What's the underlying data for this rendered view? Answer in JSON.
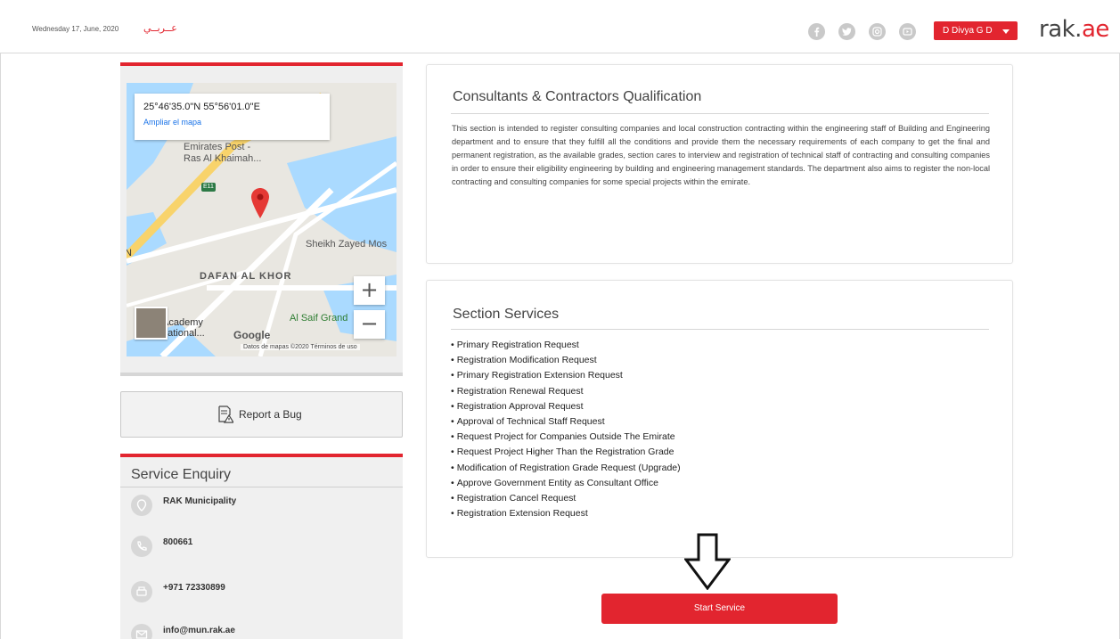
{
  "header": {
    "date": "Wednesday 17, June, 2020",
    "language_link": "عــربــي",
    "user_label": "D Divya G D",
    "brand_prefix": "rak.",
    "brand_suffix": "ae",
    "social_icons": [
      "facebook-icon",
      "twitter-icon",
      "instagram-icon",
      "youtube-icon"
    ]
  },
  "map": {
    "coordinates": "25°46'35.0\"N 55°56'01.0\"E",
    "expand_link": "Ampliar el mapa",
    "labels": {
      "emirates_post": "Emirates Post -",
      "ras_al_khaimah": "Ras Al Khaimah...",
      "sheikh_zayed": "Sheikh Zayed Mos",
      "dafan_al_khor": "DAFAN AL KHOR",
      "al_saif_grand": "Al Saif Grand",
      "academy": "Academy",
      "national": "national...",
      "road_e11": "E11",
      "side_n": "N"
    },
    "google_logo": "Google",
    "attribution": "Datos de mapas ©2020   Términos de uso",
    "zoom_in": "+",
    "zoom_out": "−"
  },
  "report_bug": {
    "label": "Report a Bug"
  },
  "service_enquiry": {
    "title": "Service Enquiry",
    "items": [
      {
        "icon": "location-icon",
        "text": "RAK Municipality"
      },
      {
        "icon": "phone-icon",
        "text": "800661"
      },
      {
        "icon": "fax-icon",
        "text": "+971 72330899"
      },
      {
        "icon": "email-icon",
        "text": "info@mun.rak.ae"
      }
    ]
  },
  "qualification": {
    "title": "Consultants & Contractors Qualification",
    "description": "This section is intended to register consulting companies and local construction contracting within the engineering staff of Building and Engineering department and to ensure that they fulfill all the conditions and provide them the necessary requirements of each company to get the final and permanent registration, as the available grades, section cares to interview and registration of technical staff of contracting and consulting companies in order to ensure their eligibility engineering by building and engineering management standards. The department also aims to register the non-local contracting and consulting companies for some special projects within the emirate."
  },
  "section_services": {
    "title": "Section Services",
    "items": [
      "Primary Registration Request",
      "Registration Modification Request",
      "Primary Registration Extension Request",
      "Registration Renewal Request",
      "Registration Approval Request",
      "Approval of Technical Staff Request",
      "Request Project for Companies Outside The Emirate",
      "Request Project Higher Than the Registration Grade",
      "Modification of Registration Grade Request (Upgrade)",
      "Approve Government Entity as Consultant Office",
      "Registration Cancel Request",
      "Registration Extension Request"
    ]
  },
  "start_service": {
    "label": "Start Service"
  },
  "colors": {
    "accent": "#e2252f",
    "panel": "#f0f0f0",
    "border": "#e3e3e3"
  }
}
